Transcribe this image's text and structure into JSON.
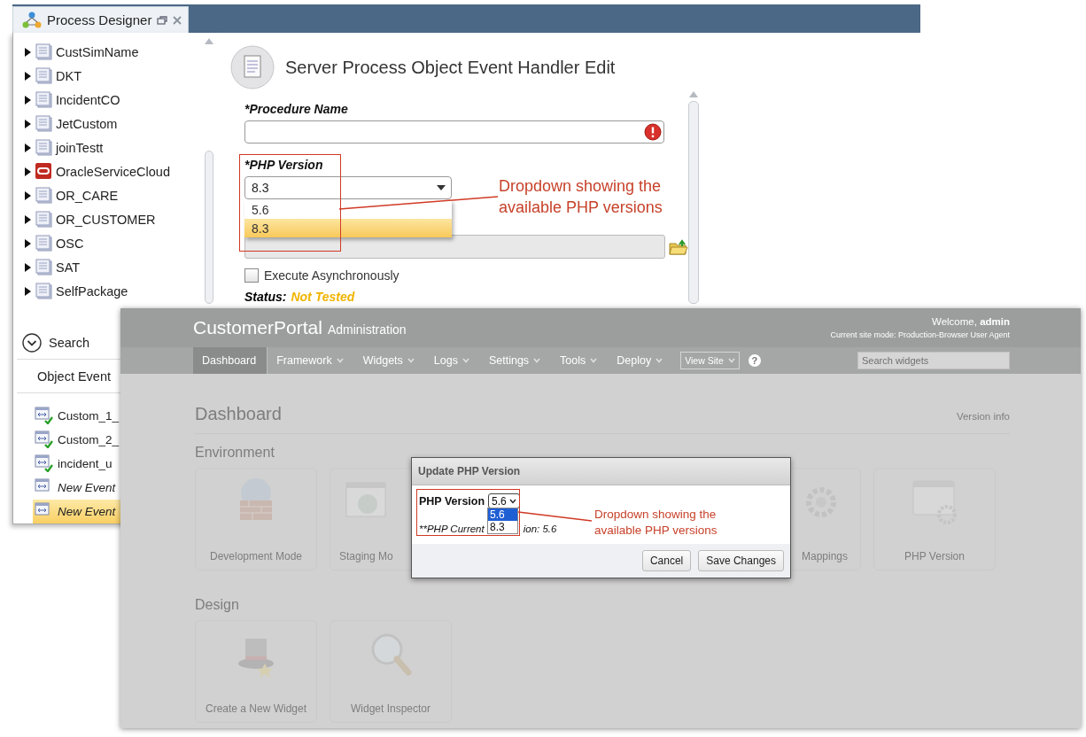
{
  "designer": {
    "tab": {
      "title": "Process Designer"
    },
    "tree": [
      {
        "label": "CustSimName",
        "kind": "package",
        "expanded": false
      },
      {
        "label": "DKT",
        "kind": "package",
        "expanded": false
      },
      {
        "label": "IncidentCO",
        "kind": "package",
        "expanded": false
      },
      {
        "label": "JetCustom",
        "kind": "package",
        "expanded": false
      },
      {
        "label": "joinTestt",
        "kind": "package",
        "expanded": false
      },
      {
        "label": "OracleServiceCloud",
        "kind": "oracle",
        "expanded": false
      },
      {
        "label": "OR_CARE",
        "kind": "package",
        "expanded": false
      },
      {
        "label": "OR_CUSTOMER",
        "kind": "package",
        "expanded": false
      },
      {
        "label": "OSC",
        "kind": "package",
        "expanded": false
      },
      {
        "label": "SAT",
        "kind": "package",
        "expanded": false
      },
      {
        "label": "SelfPackage",
        "kind": "package",
        "expanded": false
      }
    ],
    "search": {
      "label": "Search"
    },
    "section_title": "Object Event",
    "handlers": [
      {
        "label": "Custom_1_",
        "kind": "deployed",
        "selected": false
      },
      {
        "label": "Custom_2_",
        "kind": "deployed",
        "selected": false
      },
      {
        "label": "incident_u",
        "kind": "deployed",
        "selected": false
      },
      {
        "label": "New Event",
        "kind": "draft",
        "selected": false
      },
      {
        "label": "New Event",
        "kind": "draft",
        "selected": true
      }
    ]
  },
  "editor": {
    "title": "Server Process Object Event Handler Edit",
    "procedure_name": {
      "label": "*Procedure Name",
      "error": true
    },
    "php_version": {
      "label": "*PHP Version",
      "value": "8.3",
      "options": [
        {
          "label": "5.6",
          "selected": false
        },
        {
          "label": "8.3",
          "selected": true
        }
      ]
    },
    "execute_async": {
      "label": "Execute Asynchronously",
      "checked": false
    },
    "status": {
      "label": "Status:",
      "value": "Not Tested"
    }
  },
  "portal": {
    "brand": "CustomerPortal",
    "subtitle": "Administration",
    "welcome": "Welcome, **admin**",
    "site_mode": "Current site mode: Production-Browser User Agent",
    "nav": [
      {
        "label": "Dashboard",
        "kind": "link",
        "selected": true
      },
      {
        "label": "Framework",
        "kind": "menu",
        "selected": false
      },
      {
        "label": "Widgets",
        "kind": "menu",
        "selected": false
      },
      {
        "label": "Logs",
        "kind": "menu",
        "selected": false
      },
      {
        "label": "Settings",
        "kind": "menu",
        "selected": false
      },
      {
        "label": "Tools",
        "kind": "menu",
        "selected": false
      },
      {
        "label": "Deploy",
        "kind": "menu",
        "selected": false
      },
      {
        "label": "View Site",
        "kind": "pill",
        "selected": false
      }
    ],
    "help": "?",
    "search": {
      "placeholder": "Search widgets"
    },
    "heading": "Dashboard",
    "version_link": "Version info",
    "sections": [
      {
        "title": "Environment",
        "cards": [
          {
            "label": "Development Mode",
            "kind": "globe"
          },
          {
            "label": "Staging Mo",
            "kind": "window"
          },
          {
            "label": "Mappings",
            "kind": "gear"
          },
          {
            "label": "PHP Version",
            "kind": "window-gear"
          }
        ]
      },
      {
        "title": "Design",
        "cards": [
          {
            "label": "Create a New Widget",
            "kind": "hat"
          },
          {
            "label": "Widget Inspector",
            "kind": "magnifier"
          }
        ]
      }
    ]
  },
  "dialog": {
    "title": "Update PHP Version",
    "label": "PHP Version",
    "value": "5.6",
    "options": [
      {
        "label": "5.6",
        "selected": true
      },
      {
        "label": "8.3",
        "selected": false
      }
    ],
    "current_version": [
      "**PHP Current",
      "ion: 5.6"
    ],
    "buttons": [
      "Cancel",
      "Save Changes"
    ]
  },
  "annotations": [
    {
      "text": "Dropdown showing the available PHP versions"
    },
    {
      "text": "Dropdown showing the available PHP versions"
    }
  ]
}
